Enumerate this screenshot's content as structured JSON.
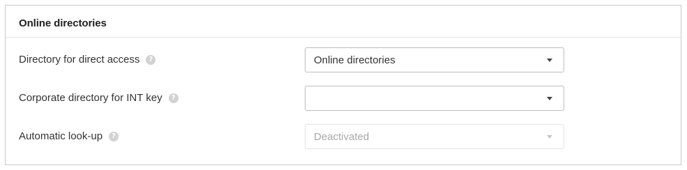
{
  "section": {
    "title": "Online directories"
  },
  "rows": [
    {
      "label": "Directory for direct access",
      "help": "?",
      "value": "Online directories",
      "disabled": false
    },
    {
      "label": "Corporate directory for INT key",
      "help": "?",
      "value": "",
      "disabled": false
    },
    {
      "label": "Automatic look-up",
      "help": "?",
      "value": "Deactivated",
      "disabled": true
    }
  ],
  "icons": {
    "help": "question-mark-circle-icon",
    "dropdown": "caret-down-icon"
  },
  "colors": {
    "border": "#c9c9c9",
    "help_icon": "#d2d2d2",
    "disabled_text": "#a8a8a8"
  }
}
